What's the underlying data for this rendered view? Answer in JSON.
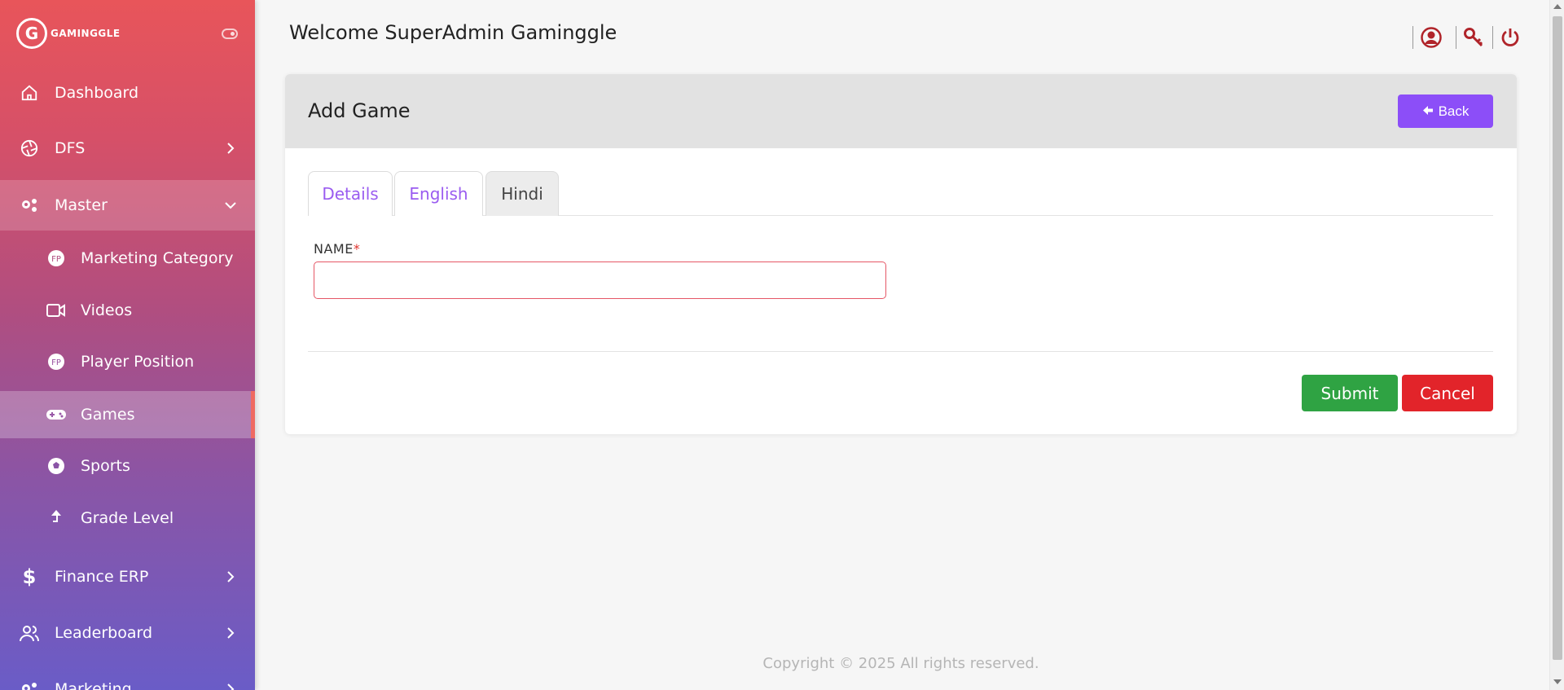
{
  "brand": {
    "logo_letter": "G",
    "name": "GAMINGGLE"
  },
  "header": {
    "welcome": "Welcome SuperAdmin Gaminggle"
  },
  "sidebar": {
    "items": [
      {
        "label": "Dashboard",
        "icon": "home-icon"
      },
      {
        "label": "DFS",
        "icon": "aperture-icon",
        "expandable": true
      },
      {
        "label": "Master",
        "icon": "gears-icon",
        "expanded": true
      },
      {
        "label": "Marketing Category",
        "icon": "badge-icon",
        "sub": true
      },
      {
        "label": "Videos",
        "icon": "video-icon",
        "sub": true
      },
      {
        "label": "Player Position",
        "icon": "badge-icon",
        "sub": true
      },
      {
        "label": "Games",
        "icon": "gamepad-icon",
        "sub": true,
        "active": true
      },
      {
        "label": "Sports",
        "icon": "soccer-ball-icon",
        "sub": true
      },
      {
        "label": "Grade Level",
        "icon": "arrow-up-icon",
        "sub": true
      },
      {
        "label": "Finance ERP",
        "icon": "dollar-icon",
        "expandable": true
      },
      {
        "label": "Leaderboard",
        "icon": "users-icon",
        "expandable": true
      },
      {
        "label": "Marketing",
        "icon": "gears-icon",
        "expandable": true
      }
    ]
  },
  "card": {
    "title": "Add Game",
    "back_label": "Back",
    "tabs": [
      {
        "label": "Details"
      },
      {
        "label": "English"
      },
      {
        "label": "Hindi",
        "active": true
      }
    ],
    "field": {
      "label": "NAME",
      "required_mark": "*",
      "value": "",
      "placeholder": ""
    },
    "submit_label": "Submit",
    "cancel_label": "Cancel"
  },
  "footer": {
    "text": "Copyright © 2025  All rights reserved."
  },
  "colors": {
    "accent": "#8c4ef8",
    "submit": "#2fa343",
    "cancel": "#e2242a",
    "header_icons": "#b0242a"
  }
}
